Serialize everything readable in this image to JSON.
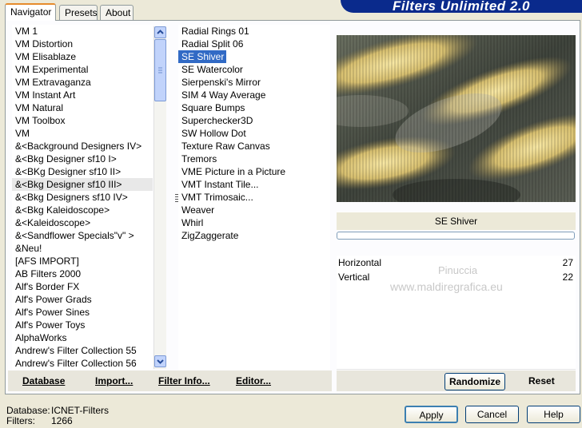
{
  "tabs": [
    "Navigator",
    "Presets",
    "About"
  ],
  "banner": "Filters Unlimited 2.0",
  "categories": [
    "VM 1",
    "VM Distortion",
    "VM Elisablaze",
    "VM Experimental",
    "VM Extravaganza",
    "VM Instant Art",
    "VM Natural",
    "VM Toolbox",
    "VM",
    "&<Background Designers IV>",
    "&<Bkg Designer sf10 I>",
    "&<BKg Designer sf10 II>",
    "&<Bkg Designer sf10 III>",
    "&<Bkg Designers sf10 IV>",
    "&<Bkg Kaleidoscope>",
    "&<Kaleidoscope>",
    "&<Sandflower Specials\"v\" >",
    "&Neu!",
    "[AFS IMPORT]",
    "AB Filters 2000",
    "Alf's Border FX",
    "Alf's Power Grads",
    "Alf's Power Sines",
    "Alf's Power Toys",
    "AlphaWorks",
    "Andrew's Filter Collection 55",
    "Andrew's Filter Collection 56"
  ],
  "filters": [
    "Radial  Rings 01",
    "Radial Split 06",
    "SE Shiver",
    "SE Watercolor",
    "Sierpenski's Mirror",
    "SIM 4 Way Average",
    "Square Bumps",
    "Superchecker3D",
    "SW Hollow Dot",
    "Texture Raw Canvas",
    "Tremors",
    "VME Picture in a Picture",
    "VMT Instant Tile...",
    "VMT Trimosaic...",
    "Weaver",
    "Whirl",
    "ZigZaggerate"
  ],
  "selected_filter": "SE Shiver",
  "params": [
    {
      "label": "Horizontal",
      "value": "27"
    },
    {
      "label": "Vertical",
      "value": "22"
    }
  ],
  "watermark": [
    "Pinuccia",
    "www.maldiregrafica.eu"
  ],
  "buttons": {
    "database": "Database",
    "import": "Import...",
    "filter_info": "Filter Info...",
    "editor": "Editor...",
    "randomize": "Randomize",
    "reset": "Reset",
    "apply": "Apply",
    "cancel": "Cancel",
    "help": "Help"
  },
  "status": {
    "database_label": "Database:",
    "database_value": "ICNET-Filters",
    "filters_label": "Filters:",
    "filters_value": "1266"
  },
  "colors": {
    "selection": "#316ac5",
    "banner": "#0a2a8c",
    "tab_active": "#e68b2c"
  }
}
